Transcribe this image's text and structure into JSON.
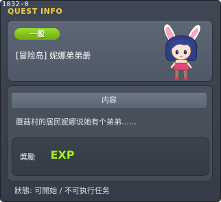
{
  "quest_id": "1032-0",
  "header": {
    "title": "QUEST INFO"
  },
  "quest": {
    "category": "一般",
    "name": "[冒险岛] 妮娜弟弟册",
    "section_title": "内容",
    "description": "蘑菇村的居民妮娜说她有个弟弟……",
    "reward_label": "獎勵",
    "reward_icon_text": "EXP",
    "status": "狀態: 可開始 / 不可执行任务"
  },
  "colors": {
    "title_yellow": "#f0d23a",
    "badge_green": "#8ccd24",
    "exp_green": "#9ee52b",
    "panel": "#56606e",
    "window": "#3b424e"
  }
}
